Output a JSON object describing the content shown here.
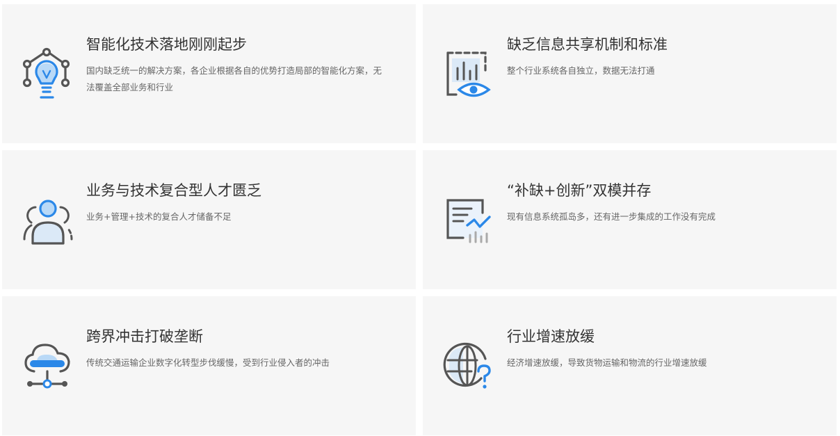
{
  "cards": [
    {
      "title": "智能化技术落地刚刚起步",
      "desc": "国内缺乏统一的解决方案，各企业根据各自的优势打造局部的智能化方案，无法覆盖全部业务和行业",
      "icon": "lightbulb-network-icon"
    },
    {
      "title": "缺乏信息共享机制和标准",
      "desc": "整个行业系统各自独立，数据无法打通",
      "icon": "chart-eye-icon"
    },
    {
      "title": "业务与技术复合型人才匮乏",
      "desc": "业务+管理+技术的复合人才储备不足",
      "icon": "user-team-icon"
    },
    {
      "title": "“补缺+创新”双模并存",
      "desc": "现有信息系统孤岛多，还有进一步集成的工作没有完成",
      "icon": "report-trend-icon"
    },
    {
      "title": "跨界冲击打破垄断",
      "desc": "传统交通运输企业数字化转型步伐缓慢，受到行业侵入者的冲击",
      "icon": "cloud-network-icon"
    },
    {
      "title": "行业增速放缓",
      "desc": "经济增速放缓，导致货物运输和物流的行业增速放缓",
      "icon": "globe-question-icon"
    }
  ],
  "colors": {
    "accent": "#2b88e8",
    "accent_light": "#b9d9f7",
    "icon_gray": "#555555",
    "card_bg": "#f6f6f6"
  }
}
